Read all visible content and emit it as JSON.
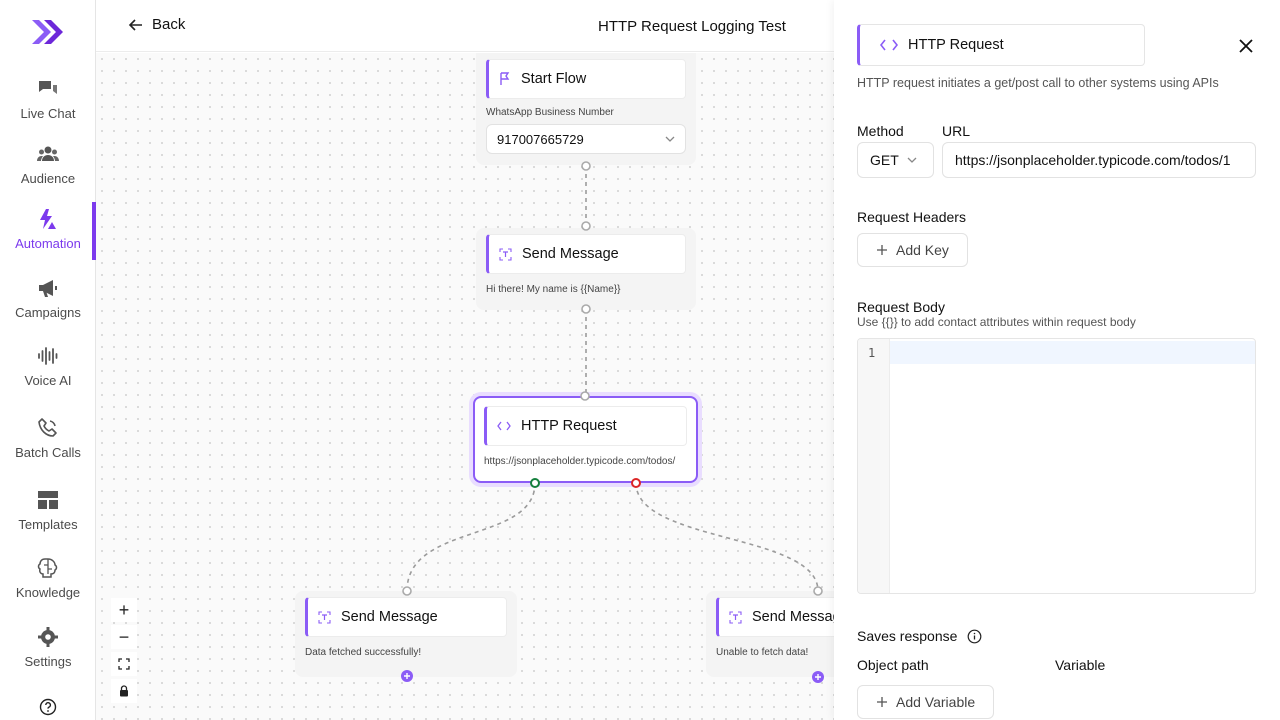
{
  "app": {
    "brand_color": "#7c3aed",
    "nav": [
      {
        "label": "Live Chat",
        "icon": "chat-icon"
      },
      {
        "label": "Audience",
        "icon": "users-icon"
      },
      {
        "label": "Automation",
        "icon": "automation-icon",
        "active": true
      },
      {
        "label": "Campaigns",
        "icon": "megaphone-icon"
      },
      {
        "label": "Voice AI",
        "icon": "waveform-icon"
      },
      {
        "label": "Batch Calls",
        "icon": "phone-icon"
      },
      {
        "label": "Templates",
        "icon": "templates-icon"
      },
      {
        "label": "Knowledge",
        "icon": "brain-icon"
      },
      {
        "label": "Settings",
        "icon": "gear-icon"
      }
    ]
  },
  "topbar": {
    "back_label": "Back",
    "title": "HTTP Request Logging Test"
  },
  "canvas": {
    "nodes": {
      "start": {
        "title": "Start Flow",
        "field_label": "WhatsApp Business Number",
        "field_value": "917007665729"
      },
      "send1": {
        "title": "Send Message",
        "text": "Hi there! My name is {{Name}}"
      },
      "http": {
        "title": "HTTP Request",
        "text": "https://jsonplaceholder.typicode.com/todos/"
      },
      "success": {
        "title": "Send Message",
        "text": "Data fetched successfully!"
      },
      "failure": {
        "title": "Send Message",
        "text": "Unable to fetch data!"
      }
    },
    "zoom_controls": {
      "zoom_in": "+",
      "zoom_out": "−"
    }
  },
  "panel": {
    "title": "HTTP Request",
    "description": "HTTP request initiates a get/post call to other systems using APIs",
    "method_label": "Method",
    "method_value": "GET",
    "url_label": "URL",
    "url_value": "https://jsonplaceholder.typicode.com/todos/1",
    "headers_label": "Request Headers",
    "add_key_label": "Add Key",
    "body_label": "Request Body",
    "body_hint": "Use {{}} to add contact attributes within request body",
    "line_number": "1",
    "saves_response_label": "Saves response",
    "object_path_label": "Object path",
    "variable_label": "Variable",
    "add_variable_label": "Add Variable"
  }
}
